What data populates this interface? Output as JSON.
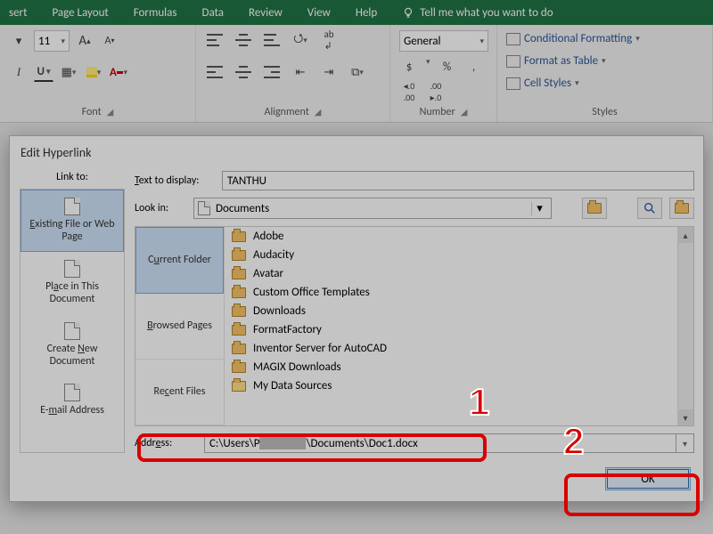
{
  "ribbon": {
    "tabs": [
      "sert",
      "Page Layout",
      "Formulas",
      "Data",
      "Review",
      "View",
      "Help"
    ],
    "tell_me": "Tell me what you want to do",
    "font": {
      "title": "Font",
      "size": "11"
    },
    "alignment": {
      "title": "Alignment"
    },
    "number": {
      "title": "Number",
      "format": "General",
      "currency": "$",
      "percent": "%",
      "comma": ",",
      "inc": ".00",
      "dec": ".0"
    },
    "styles": {
      "title": "Styles",
      "conditional": "Conditional Formatting",
      "table": "Format as Table",
      "cell": "Cell Styles"
    }
  },
  "dialog": {
    "title": "Edit Hyperlink",
    "linkto_label": "Link to:",
    "linkto": {
      "existing": "Existing File or Web Page",
      "place": "Place in This Document",
      "create": "Create New Document",
      "email": "E-mail Address"
    },
    "text_to_display_label": "Text to display:",
    "text_to_display": "TANTHU",
    "look_in_label": "Look in:",
    "look_in": "Documents",
    "browse_tabs": {
      "current": "Current Folder",
      "browsed": "Browsed Pages",
      "recent": "Recent Files"
    },
    "files": [
      "Adobe",
      "Audacity",
      "Avatar",
      "Custom Office Templates",
      "Downloads",
      "FormatFactory",
      "Inventor Server for AutoCAD",
      "MAGIX Downloads",
      "My Data Sources"
    ],
    "address_label": "Address:",
    "address_left": "C:\\Users\\P",
    "address_right": "\\Documents\\Doc1.docx",
    "ok": "OK"
  },
  "annotations": {
    "one": "1",
    "two": "2"
  }
}
